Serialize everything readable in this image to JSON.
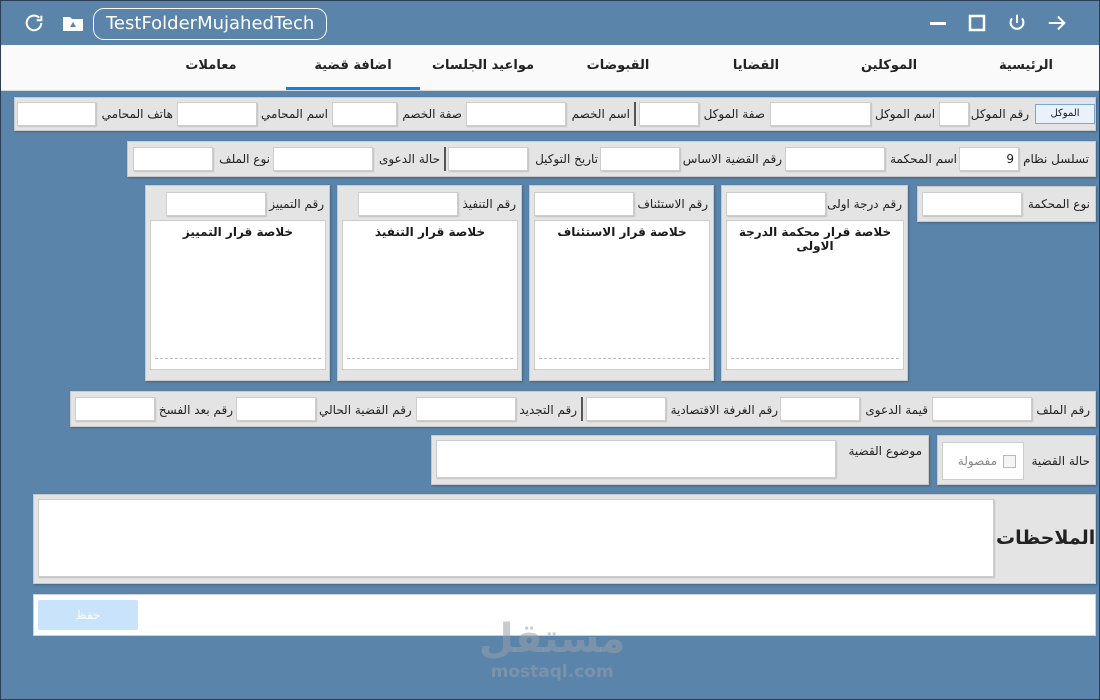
{
  "window": {
    "title": "TestFolderMujahedTech"
  },
  "titlebar_icons": [
    "refresh-icon",
    "drive-icon",
    "minimize-icon",
    "maximize-icon",
    "power-icon",
    "forward-arrow-icon"
  ],
  "tabs": [
    {
      "label": "الرئيسية",
      "active": false
    },
    {
      "label": "الموكلين",
      "active": false
    },
    {
      "label": "القضايا",
      "active": false
    },
    {
      "label": "القبوضات",
      "active": false
    },
    {
      "label": "مواعيد الجلسات",
      "active": false
    },
    {
      "label": "اضافة قضية",
      "active": true
    },
    {
      "label": "معاملات",
      "active": false
    }
  ],
  "row1": {
    "client_button": "الموكل",
    "client_number": "رقم الموكل",
    "client_name": "اسم الموكل",
    "client_role": "صفة الموكل",
    "opponent_name": "اسم الخصم",
    "opponent_role": "صفة الخصم",
    "lawyer_name": "اسم المحامي",
    "lawyer_phone": "هاتف المحامي"
  },
  "row2": {
    "seq_label": "تسلسل نظام",
    "seq_value": "9",
    "court_name": "اسم المحكمة",
    "base_case_number": "رقم القضية الاساس",
    "power_of_attorney_date": "تاريخ التوكيل",
    "lawsuit_status": "حالة الدعوى",
    "file_type": "نوع الملف"
  },
  "court_type": "نوع المحكمة",
  "decision_cards": [
    {
      "number_label": "رقم درجة اولى",
      "summary_title": "خلاصة قرار محكمة الدرجة الاولى"
    },
    {
      "number_label": "رقم الاستئناف",
      "summary_title": "خلاصة قرار الاستئناف"
    },
    {
      "number_label": "رقم التنفيذ",
      "summary_title": "خلاصة قرار التنفيذ"
    },
    {
      "number_label": "رقم التمييز",
      "summary_title": "خلاصة قرار التمييز"
    }
  ],
  "row3": {
    "file_number": "رقم الملف",
    "lawsuit_value": "قيمة الدعوى",
    "economic_chamber_number": "رقم الغرفة الاقتصادية",
    "renewal_number": "رقم التجديد",
    "current_case_number": "رقم القضية الحالي",
    "post_annulment_number": "رقم بعد الفسخ"
  },
  "case_status": {
    "label": "حالة القضية",
    "checkbox_label": "مفصولة",
    "checked": false
  },
  "case_subject": {
    "label": "موضوع القضية"
  },
  "notes": {
    "label": "الملاحظات"
  },
  "save_button": "حفظ",
  "watermark": {
    "arabic": "مستقل",
    "latin": "mostaql.com"
  }
}
